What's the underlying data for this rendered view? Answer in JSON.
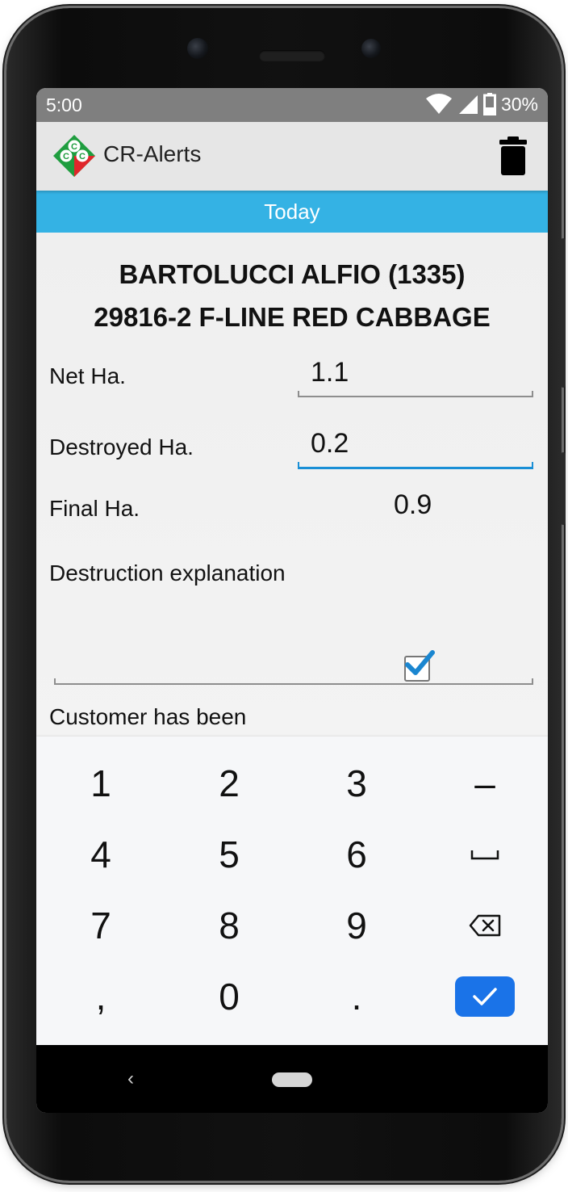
{
  "status_bar": {
    "time": "5:00",
    "battery": "30%",
    "icons": [
      "wifi-icon",
      "cell-signal-icon",
      "battery-icon"
    ]
  },
  "app_bar": {
    "title": "CR-Alerts",
    "logo_letters": [
      "C",
      "C",
      "C"
    ],
    "action_icon": "trash-icon"
  },
  "date_band": {
    "label": "Today"
  },
  "record": {
    "customer": "BARTOLUCCI ALFIO (1335)",
    "product": "29816-2 F-LINE RED CABBAGE"
  },
  "form": {
    "net_label": "Net Ha.",
    "net_value": "1.1",
    "destroyed_label": "Destroyed Ha.",
    "destroyed_value": "0.2",
    "final_label": "Final Ha.",
    "final_value": "0.9",
    "explanation_label": "Destruction explanation",
    "explanation_value": "",
    "customer_notified_label": "Customer has been",
    "customer_notified_checked": true
  },
  "keyboard": {
    "rows": [
      [
        "1",
        "2",
        "3",
        "–"
      ],
      [
        "4",
        "5",
        "6",
        "␣"
      ],
      [
        "7",
        "8",
        "9",
        "backspace-icon"
      ],
      [
        ",",
        "0",
        ".",
        "done-check-icon"
      ]
    ]
  },
  "nav_bar": {
    "back": "‹",
    "home": "home-pill"
  },
  "colors": {
    "accent_band": "#34b2e4",
    "status_bar": "#7f7f7f",
    "app_bar": "#e6e6e6",
    "focus": "#1a8fd6",
    "done_key": "#1a73e8",
    "logo_green": "#1f9d3f",
    "logo_red": "#e0262b"
  }
}
